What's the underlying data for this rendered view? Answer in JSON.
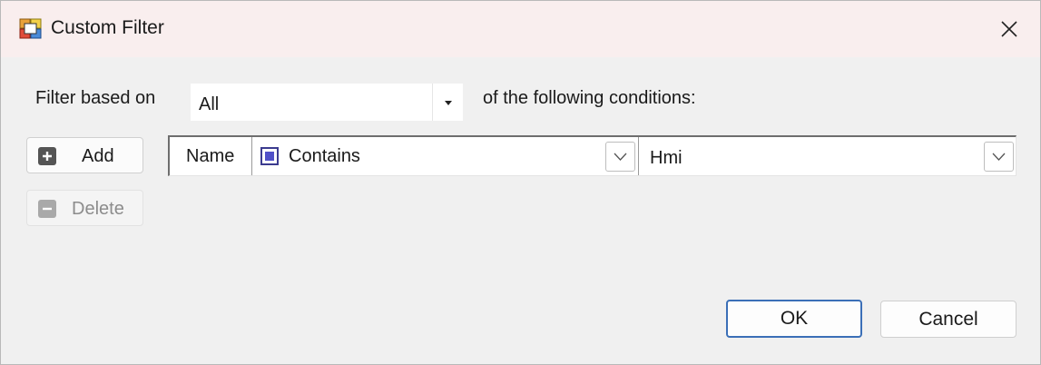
{
  "window": {
    "title": "Custom Filter",
    "icon": "custom-filter-app-icon",
    "close_icon": "close-icon"
  },
  "filter_based_on": {
    "label": "Filter based on",
    "value": "All",
    "suffix": "of the following conditions:"
  },
  "buttons": {
    "add": "Add",
    "delete": "Delete",
    "ok": "OK",
    "cancel": "Cancel"
  },
  "conditions": [
    {
      "field": "Name",
      "operator": "Contains",
      "value": "Hmi"
    }
  ],
  "colors": {
    "titlebar": "#f9eeee",
    "ok_border": "#3b6fb7",
    "operator_icon": "#5050c8"
  }
}
